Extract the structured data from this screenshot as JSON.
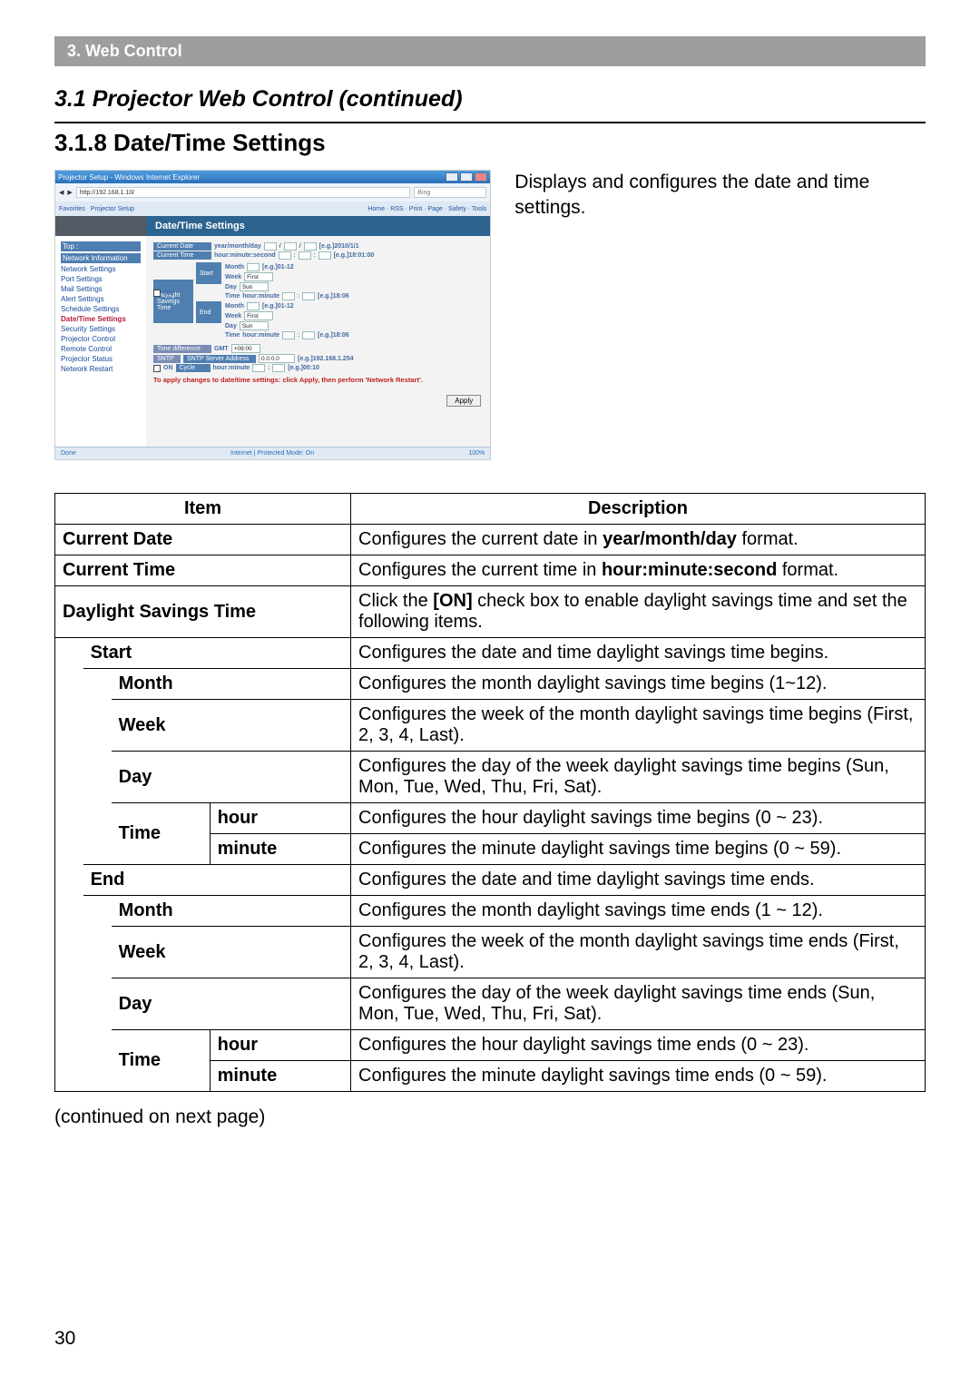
{
  "banner": "3. Web Control",
  "subtitle": "3.1 Projector Web Control (continued)",
  "heading": "3.1.8 Date/Time Settings",
  "intro": "Displays and configures the date and time settings.",
  "screenshot": {
    "window_title": "Projector Setup - Windows Internet Explorer",
    "url": "http://192.168.1.10/",
    "search_placeholder": "Bing",
    "fav": "Favorites",
    "tab": "Projector Setup",
    "toolbar": "Home · RSS · Print · Page · Safety · Tools",
    "panel_title": "Date/Time Settings",
    "sidebar": {
      "top": "Top :",
      "items": [
        "Network Information",
        "Network Settings",
        "Port Settings",
        "Mail Settings",
        "Alert Settings",
        "Schedule Settings",
        "Date/Time Settings",
        "Security Settings",
        "Projector Control",
        "Remote Control",
        "Projector Status",
        "Network Restart"
      ]
    },
    "labels": {
      "current_date": "Current Date",
      "current_time": "Current Time",
      "dst": "Daylight Savings Time",
      "on": "ON",
      "start": "Start",
      "end": "End",
      "month": "Month",
      "week": "Week",
      "day": "Day",
      "time": "Time",
      "hourmin": "hour:minute",
      "gmt": "GMT",
      "td": "Time difference",
      "sntp": "SNTP",
      "sntp_addr": "SNTP Server Address",
      "cycle": "Cycle",
      "ymd": "year/month/day",
      "hms": "hour:minute:second"
    },
    "hints": {
      "date": "[e.g.]2010/1/1",
      "time": "[e.g.]18:01:00",
      "month": "[e.g.]01-12",
      "hm": "[e.g.]18:06",
      "sntp": "[e.g.]192.168.1.254",
      "cycle": "[e.g.]00:10"
    },
    "vals": {
      "week": "First",
      "day": "Sun",
      "gmt": "+09:00",
      "sntp_addr": "0.0.0.0"
    },
    "warn": "To apply changes to date/time settings: click Apply, then perform 'Network Restart'.",
    "apply": "Apply",
    "status_left": "Done",
    "status_mid": "Internet | Protected Mode: On",
    "status_right": "100%"
  },
  "table": {
    "head_item": "Item",
    "head_desc": "Description",
    "current_date": {
      "item": "Current Date",
      "desc_a": "Configures the current date in ",
      "desc_b": "year/month/day",
      "desc_c": " format."
    },
    "current_time": {
      "item": "Current Time",
      "desc_a": "Configures the current time in ",
      "desc_b": "hour:minute:second",
      "desc_c": " format."
    },
    "dst": {
      "item": "Daylight Savings Time",
      "desc_a": "Click the ",
      "desc_b": "[ON]",
      "desc_c": " check box to enable daylight savings time and set the following items."
    },
    "start": {
      "item": "Start",
      "desc": "Configures the date and time daylight savings time begins."
    },
    "start_month": {
      "item": "Month",
      "desc": "Configures the month daylight savings time begins (1~12)."
    },
    "start_week": {
      "item": "Week",
      "desc": "Configures the week of the month daylight savings time begins (First, 2, 3, 4, Last)."
    },
    "start_day": {
      "item": "Day",
      "desc": "Configures the day of the week daylight savings time begins (Sun, Mon, Tue, Wed, Thu, Fri, Sat)."
    },
    "start_time": {
      "item": "Time"
    },
    "start_hour": {
      "item": "hour",
      "desc": "Configures the hour daylight savings time begins (0 ~ 23)."
    },
    "start_minute": {
      "item": "minute",
      "desc": "Configures the minute daylight savings time begins (0 ~ 59)."
    },
    "end": {
      "item": "End",
      "desc": "Configures the date and time daylight savings time ends."
    },
    "end_month": {
      "item": "Month",
      "desc": "Configures the month daylight savings time ends (1 ~ 12)."
    },
    "end_week": {
      "item": "Week",
      "desc": "Configures the week of the month daylight savings time ends (First, 2, 3, 4, Last)."
    },
    "end_day": {
      "item": "Day",
      "desc": "Configures the day of the week daylight savings time ends (Sun, Mon, Tue, Wed, Thu, Fri, Sat)."
    },
    "end_time": {
      "item": "Time"
    },
    "end_hour": {
      "item": "hour",
      "desc": "Configures the hour daylight savings time ends (0 ~ 23)."
    },
    "end_minute": {
      "item": "minute",
      "desc": "Configures the minute daylight savings time ends (0 ~ 59)."
    }
  },
  "continued": "(continued on next page)",
  "page_number": "30"
}
